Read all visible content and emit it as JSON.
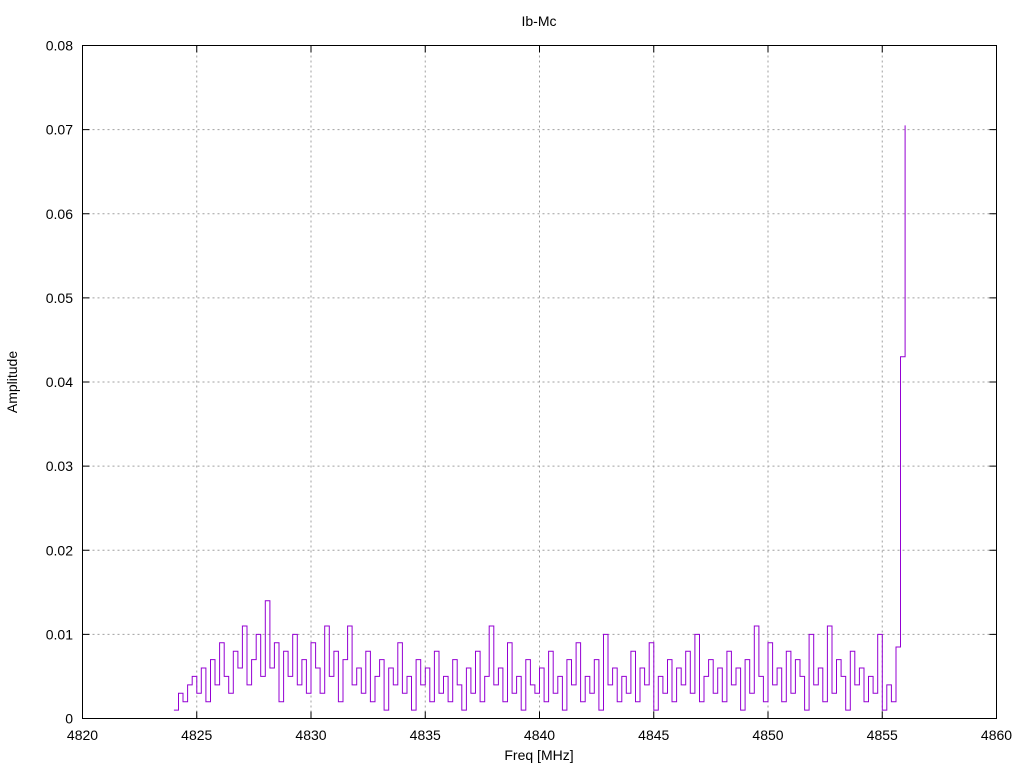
{
  "chart_data": {
    "type": "line",
    "style": "steps",
    "title": "Ib-Mc",
    "xlabel": "Freq [MHz]",
    "ylabel": "Amplitude",
    "xlim": [
      4820,
      4860
    ],
    "ylim": [
      0,
      0.08
    ],
    "grid": true,
    "xticks": [
      "4820",
      "4825",
      "4830",
      "4835",
      "4840",
      "4845",
      "4850",
      "4855",
      "4860"
    ],
    "yticks": [
      "0",
      "0.01",
      "0.02",
      "0.03",
      "0.04",
      "0.05",
      "0.06",
      "0.07",
      "0.08"
    ],
    "series": [
      {
        "name": "Ib-Mc",
        "color": "#9400d3",
        "x_start": 4824.0,
        "x_step": 0.2,
        "values": [
          0.001,
          0.003,
          0.002,
          0.004,
          0.005,
          0.003,
          0.006,
          0.002,
          0.007,
          0.004,
          0.009,
          0.005,
          0.003,
          0.008,
          0.006,
          0.011,
          0.004,
          0.007,
          0.01,
          0.005,
          0.014,
          0.006,
          0.009,
          0.002,
          0.008,
          0.005,
          0.01,
          0.004,
          0.007,
          0.003,
          0.009,
          0.006,
          0.003,
          0.011,
          0.005,
          0.008,
          0.002,
          0.007,
          0.011,
          0.004,
          0.006,
          0.003,
          0.008,
          0.002,
          0.005,
          0.007,
          0.001,
          0.006,
          0.004,
          0.009,
          0.003,
          0.005,
          0.001,
          0.007,
          0.004,
          0.006,
          0.002,
          0.008,
          0.003,
          0.005,
          0.002,
          0.007,
          0.004,
          0.001,
          0.006,
          0.003,
          0.008,
          0.002,
          0.005,
          0.011,
          0.004,
          0.006,
          0.002,
          0.009,
          0.003,
          0.005,
          0.001,
          0.007,
          0.004,
          0.003,
          0.006,
          0.002,
          0.008,
          0.003,
          0.005,
          0.001,
          0.007,
          0.004,
          0.009,
          0.002,
          0.005,
          0.003,
          0.007,
          0.001,
          0.01,
          0.004,
          0.006,
          0.002,
          0.005,
          0.003,
          0.008,
          0.002,
          0.006,
          0.004,
          0.009,
          0.001,
          0.005,
          0.003,
          0.007,
          0.002,
          0.006,
          0.004,
          0.008,
          0.003,
          0.01,
          0.002,
          0.005,
          0.007,
          0.003,
          0.006,
          0.002,
          0.008,
          0.004,
          0.006,
          0.001,
          0.007,
          0.003,
          0.011,
          0.005,
          0.002,
          0.009,
          0.004,
          0.006,
          0.002,
          0.008,
          0.003,
          0.007,
          0.005,
          0.001,
          0.01,
          0.004,
          0.006,
          0.002,
          0.011,
          0.003,
          0.007,
          0.005,
          0.001,
          0.008,
          0.004,
          0.006,
          0.002,
          0.005,
          0.003,
          0.01,
          0.001,
          0.004,
          0.002,
          0.0085,
          0.043,
          0.0705
        ]
      }
    ]
  }
}
